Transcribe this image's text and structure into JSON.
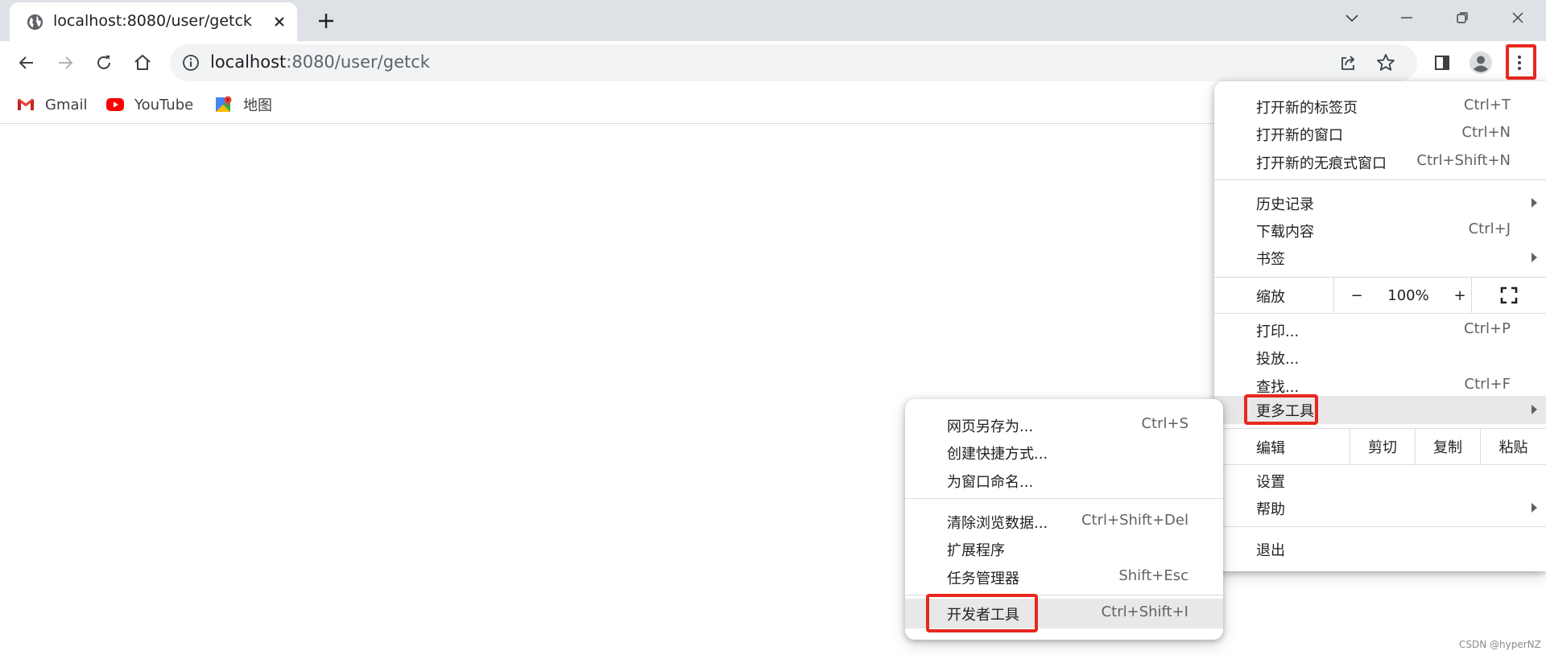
{
  "tab": {
    "title": "localhost:8080/user/getck",
    "favicon": "globe-icon"
  },
  "window_controls": [
    "chevron-down-icon",
    "minimize-icon",
    "restore-icon",
    "close-icon"
  ],
  "omnibox": {
    "host": "localhost",
    "rest": ":8080/user/getck"
  },
  "bookmarks": [
    {
      "label": "Gmail",
      "icon": "gmail-icon"
    },
    {
      "label": "YouTube",
      "icon": "youtube-icon"
    },
    {
      "label": "地图",
      "icon": "maps-icon"
    }
  ],
  "main_menu": {
    "group1": [
      {
        "label": "打开新的标签页",
        "shortcut": "Ctrl+T"
      },
      {
        "label": "打开新的窗口",
        "shortcut": "Ctrl+N"
      },
      {
        "label": "打开新的无痕式窗口",
        "shortcut": "Ctrl+Shift+N"
      }
    ],
    "group2": [
      {
        "label": "历史记录",
        "shortcut": ""
      },
      {
        "label": "下载内容",
        "shortcut": "Ctrl+J"
      },
      {
        "label": "书签",
        "shortcut": ""
      }
    ],
    "zoom": {
      "label": "缩放",
      "minus": "−",
      "value": "100%",
      "plus": "+"
    },
    "group3": [
      {
        "label": "打印...",
        "shortcut": "Ctrl+P"
      },
      {
        "label": "投放...",
        "shortcut": ""
      },
      {
        "label": "查找...",
        "shortcut": "Ctrl+F"
      },
      {
        "label": "更多工具",
        "shortcut": ""
      }
    ],
    "edit": {
      "label": "编辑",
      "cut": "剪切",
      "copy": "复制",
      "paste": "粘贴"
    },
    "group4": [
      {
        "label": "设置"
      },
      {
        "label": "帮助"
      }
    ],
    "exit": "退出"
  },
  "more_tools_menu": {
    "group1": [
      {
        "label": "网页另存为...",
        "shortcut": "Ctrl+S"
      },
      {
        "label": "创建快捷方式...",
        "shortcut": ""
      },
      {
        "label": "为窗口命名...",
        "shortcut": ""
      }
    ],
    "group2": [
      {
        "label": "清除浏览数据...",
        "shortcut": "Ctrl+Shift+Del"
      },
      {
        "label": "扩展程序",
        "shortcut": ""
      },
      {
        "label": "任务管理器",
        "shortcut": "Shift+Esc"
      }
    ],
    "devtools": {
      "label": "开发者工具",
      "shortcut": "Ctrl+Shift+I"
    }
  },
  "watermark": "CSDN @hyperNZ",
  "colors": {
    "highlight_box": "#e8281e",
    "tabstrip": "#dee1e6",
    "omnibox": "#f1f3f4"
  }
}
